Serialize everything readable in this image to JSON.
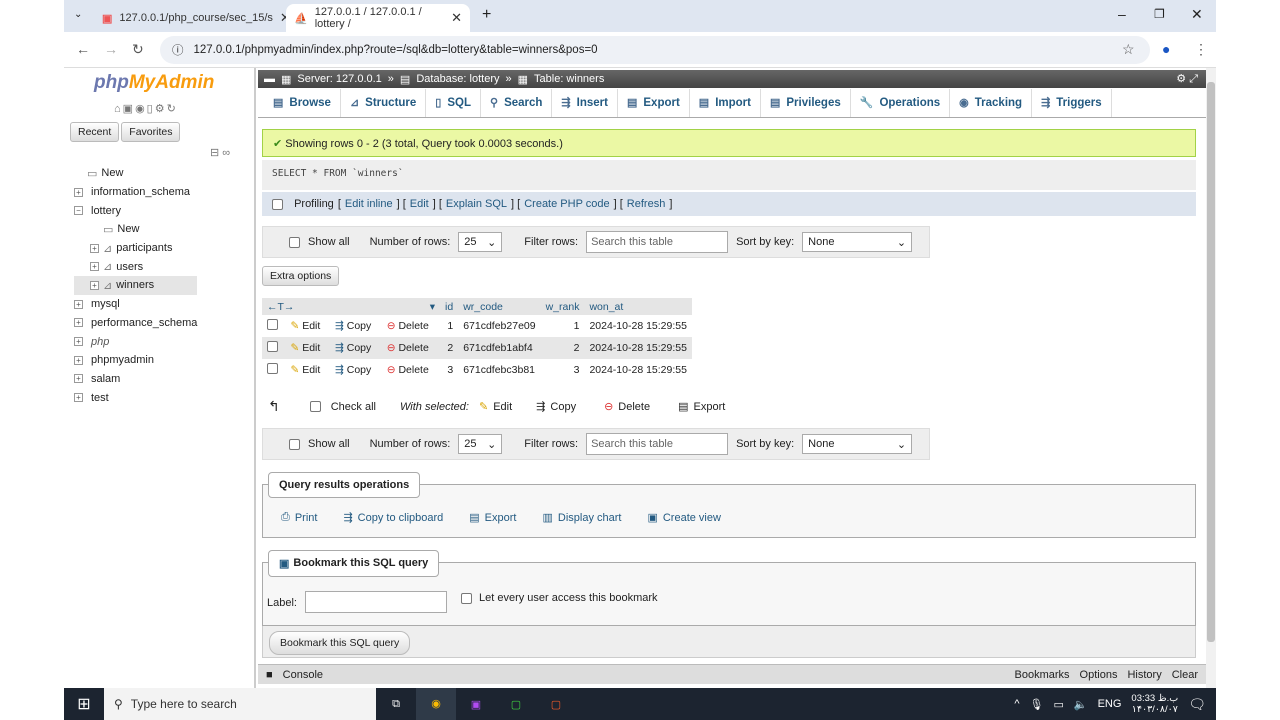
{
  "browser": {
    "tabs": [
      {
        "title": "127.0.0.1/php_course/sec_15/s"
      },
      {
        "title": "127.0.0.1 / 127.0.0.1 / lottery / "
      }
    ],
    "url": "127.0.0.1/phpmyadmin/index.php?route=/sql&db=lottery&table=winners&pos=0"
  },
  "sidebar": {
    "logo_a": "php",
    "logo_b": "MyAdmin",
    "recent": "Recent",
    "favorites": "Favorites",
    "tree": [
      {
        "label": "New",
        "level": 0
      },
      {
        "label": "information_schema",
        "level": 0
      },
      {
        "label": "lottery",
        "level": 0
      },
      {
        "label": "New",
        "level": 1
      },
      {
        "label": "participants",
        "level": 1
      },
      {
        "label": "users",
        "level": 1
      },
      {
        "label": "winners",
        "level": 1
      },
      {
        "label": "mysql",
        "level": 0
      },
      {
        "label": "performance_schema",
        "level": 0
      },
      {
        "label": "php",
        "level": 0
      },
      {
        "label": "phpmyadmin",
        "level": 0
      },
      {
        "label": "salam",
        "level": 0
      },
      {
        "label": "test",
        "level": 0
      }
    ]
  },
  "breadcrumb": {
    "server": "Server: 127.0.0.1",
    "database": "Database: lottery",
    "table": "Table: winners"
  },
  "tabs": [
    "Browse",
    "Structure",
    "SQL",
    "Search",
    "Insert",
    "Export",
    "Import",
    "Privileges",
    "Operations",
    "Tracking",
    "Triggers"
  ],
  "status": "Showing rows 0 - 2 (3 total, Query took 0.0003 seconds.)",
  "query": "SELECT * FROM `winners`",
  "profiling": {
    "label": "Profiling",
    "links": [
      "Edit inline",
      "Edit",
      "Explain SQL",
      "Create PHP code",
      "Refresh"
    ]
  },
  "nav": {
    "show_all": "Show all",
    "rows_label": "Number of rows:",
    "rows": "25",
    "filter_label": "Filter rows:",
    "filter_placeholder": "Search this table",
    "sort_label": "Sort by key:",
    "sort": "None"
  },
  "extra_options": "Extra options",
  "table": {
    "columns": [
      "id",
      "wr_code",
      "w_rank",
      "won_at"
    ],
    "actions": [
      "Edit",
      "Copy",
      "Delete"
    ],
    "rows": [
      [
        "1",
        "671cdfeb27e09",
        "1",
        "2024-10-28 15:29:55"
      ],
      [
        "2",
        "671cdfeb1abf4",
        "2",
        "2024-10-28 15:29:55"
      ],
      [
        "3",
        "671cdfebc3b81",
        "3",
        "2024-10-28 15:29:55"
      ]
    ]
  },
  "bulk": {
    "check_all": "Check all",
    "with_selected": "With selected:",
    "edit": "Edit",
    "copy": "Copy",
    "delete": "Delete",
    "export": "Export"
  },
  "qro": {
    "title": "Query results operations",
    "items": [
      "Print",
      "Copy to clipboard",
      "Export",
      "Display chart",
      "Create view"
    ]
  },
  "bookmark": {
    "title": "Bookmark this SQL query",
    "label": "Label:",
    "public": "Let every user access this bookmark",
    "button": "Bookmark this SQL query"
  },
  "console": {
    "label": "Console",
    "links": [
      "Bookmarks",
      "Options",
      "History",
      "Clear"
    ]
  },
  "taskbar": {
    "search": "Type here to search",
    "lang": "ENG",
    "time": "03:33 ب.ظ",
    "date": "۱۴۰۳/۰۸/۰۷"
  }
}
